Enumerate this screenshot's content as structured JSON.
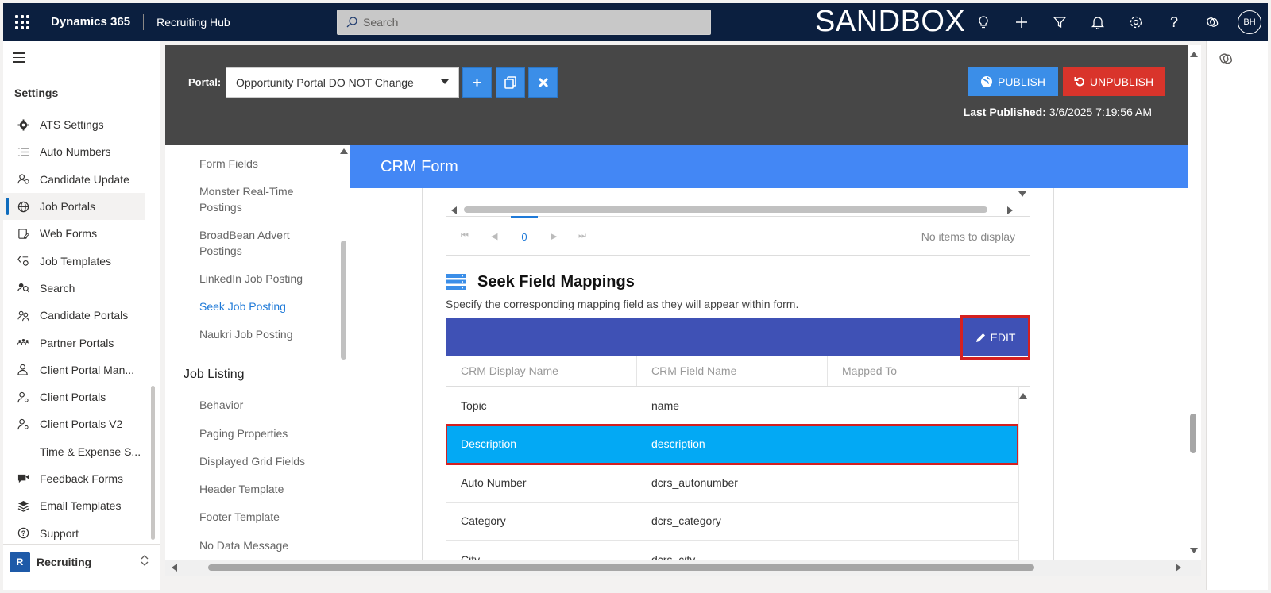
{
  "topbar": {
    "brand": "Dynamics 365",
    "app_name": "Recruiting Hub",
    "search_placeholder": "Search",
    "environment": "SANDBOX",
    "avatar_initials": "BH",
    "icons": [
      "lightbulb-icon",
      "plus-icon",
      "filter-icon",
      "bell-icon",
      "settings-icon",
      "help-icon",
      "copilot-icon"
    ]
  },
  "leftnav": {
    "title": "Settings",
    "items": [
      {
        "label": "ATS Settings",
        "icon": "gear-icon"
      },
      {
        "label": "Auto Numbers",
        "icon": "numbered-list-icon"
      },
      {
        "label": "Candidate Update",
        "icon": "person-sync-icon"
      },
      {
        "label": "Job Portals",
        "icon": "globe-icon",
        "active": true
      },
      {
        "label": "Web Forms",
        "icon": "form-edit-icon"
      },
      {
        "label": "Job Templates",
        "icon": "template-icon"
      },
      {
        "label": "Search",
        "icon": "search-people-icon"
      },
      {
        "label": "Candidate Portals",
        "icon": "people-icon"
      },
      {
        "label": "Partner Portals",
        "icon": "team-icon"
      },
      {
        "label": "Client Portal Man...",
        "icon": "person-manage-icon"
      },
      {
        "label": "Client Portals",
        "icon": "person-key-icon"
      },
      {
        "label": "Client Portals V2",
        "icon": "person-key-icon"
      },
      {
        "label": "Time & Expense S...",
        "icon": ""
      },
      {
        "label": "Feedback Forms",
        "icon": "feedback-icon"
      },
      {
        "label": "Email Templates",
        "icon": "stack-icon"
      },
      {
        "label": "Support",
        "icon": "question-circle-icon"
      }
    ],
    "area": {
      "badge": "R",
      "label": "Recruiting"
    }
  },
  "portalbar": {
    "portal_label": "Portal:",
    "portal_value": "Opportunity Portal DO NOT Change",
    "publish_label": "PUBLISH",
    "unpublish_label": "UNPUBLISH",
    "last_published_label": "Last Published:",
    "last_published_value": "3/6/2025 7:19:56 AM"
  },
  "subnav": {
    "links_top": [
      "Form Fields",
      "Monster Real-Time Postings",
      "BroadBean Advert Postings",
      "LinkedIn Job Posting",
      "Seek Job Posting",
      "Naukri Job Posting"
    ],
    "active_link": "Seek Job Posting",
    "section": "Job Listing",
    "links_bottom": [
      "Behavior",
      "Paging Properties",
      "Displayed Grid Fields",
      "Header Template",
      "Footer Template",
      "No Data Message"
    ]
  },
  "crm_form": {
    "title": "CRM Form",
    "pager": {
      "page": "0",
      "no_items": "No items to display"
    }
  },
  "seek": {
    "title": "Seek Field Mappings",
    "description": "Specify the corresponding mapping field as they will appear within form.",
    "edit_label": "EDIT",
    "columns": [
      "CRM Display Name",
      "CRM Field Name",
      "Mapped To"
    ],
    "rows": [
      {
        "display": "Topic",
        "field": "name"
      },
      {
        "display": "Description",
        "field": "description",
        "selected": true
      },
      {
        "display": "Auto Number",
        "field": "dcrs_autonumber"
      },
      {
        "display": "Category",
        "field": "dcrs_category"
      },
      {
        "display": "City",
        "field": "dcrs_city"
      }
    ]
  },
  "colors": {
    "topbar": "#0b1f3f",
    "portalbar": "#474747",
    "crm_header": "#4387f5",
    "toolbar": "#3f51b5",
    "selected_row": "#03a9f4",
    "highlight": "#d42020"
  }
}
